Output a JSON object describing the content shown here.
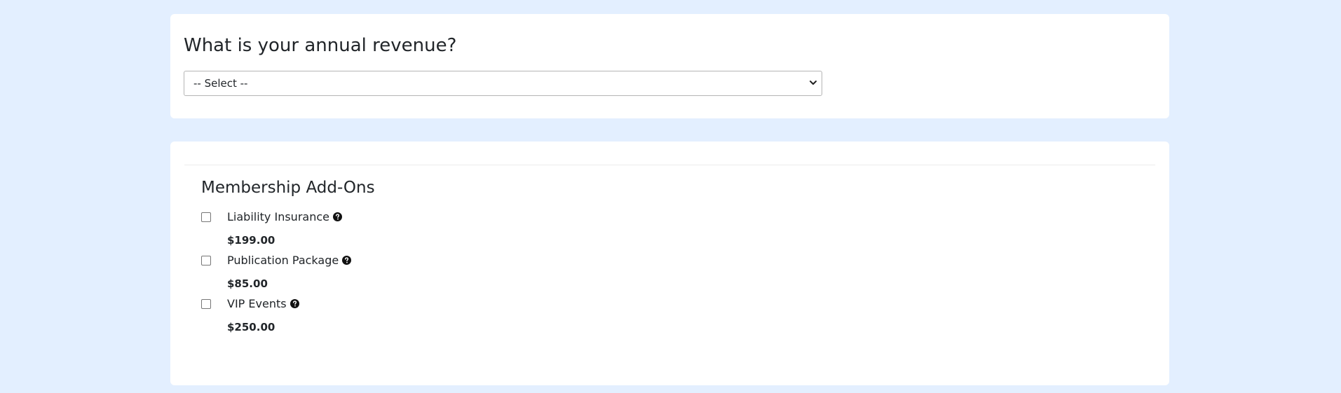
{
  "revenue_section": {
    "question": "What is your annual revenue?",
    "select_value": "-- Select --"
  },
  "addons_section": {
    "title": "Membership Add-Ons",
    "items": [
      {
        "label": "Liability Insurance",
        "price": "$199.00",
        "checked": false
      },
      {
        "label": "Publication Package",
        "price": "$85.00",
        "checked": false
      },
      {
        "label": "VIP Events",
        "price": "$250.00",
        "checked": false
      }
    ]
  },
  "icons": {
    "help": "question-circle-icon",
    "select": "chevron-down-icon"
  },
  "colors": {
    "page_background": "#e3efff",
    "card_background": "#ffffff",
    "text": "#212529"
  }
}
